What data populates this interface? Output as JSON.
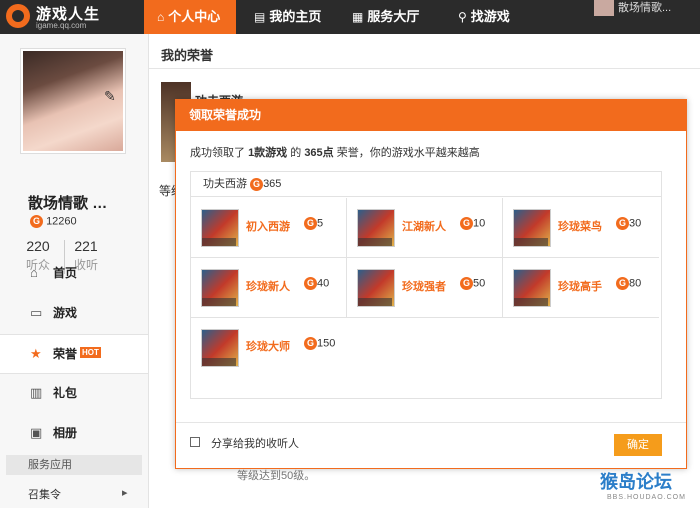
{
  "brand": {
    "name": "游戏人生",
    "subdomain": "igame.qq.com",
    "accent": "#f26b1d"
  },
  "nav": [
    {
      "label": "个人中心",
      "icon": "home-icon",
      "active": true
    },
    {
      "label": "我的主页",
      "icon": "page-icon",
      "active": false
    },
    {
      "label": "服务大厅",
      "icon": "grid-icon",
      "active": false
    },
    {
      "label": "找游戏",
      "icon": "search-icon",
      "active": false
    }
  ],
  "top_user": {
    "name": "散场情歌..."
  },
  "profile": {
    "name": "散场情歌",
    "name_suffix": "…",
    "points": "12260",
    "listeners": {
      "count": "220",
      "label": "听众"
    },
    "following": {
      "count": "221",
      "label": "收听"
    }
  },
  "sidebar": {
    "items": [
      {
        "label": "首页",
        "icon": "home-icon"
      },
      {
        "label": "游戏",
        "icon": "gamepad-icon"
      },
      {
        "label": "荣誉",
        "icon": "star-icon",
        "badge": "HOT",
        "active": true
      },
      {
        "label": "礼包",
        "icon": "gift-icon"
      },
      {
        "label": "相册",
        "icon": "photo-icon"
      }
    ],
    "section_title": "服务应用",
    "section_items": [
      {
        "label": "召集令"
      }
    ]
  },
  "main": {
    "title": "我的荣誉",
    "bg_game": "功夫西游",
    "bg_level_prefix": "等级",
    "bg_footer": "等级达到50级。"
  },
  "dialog": {
    "title": "领取荣誉成功",
    "message": {
      "p1": "成功领取了 ",
      "games": "1款游戏",
      "p2": " 的 ",
      "points": "365点",
      "p3": " 荣誉，你的游戏水平越来越高"
    },
    "game": {
      "name": "功夫西游",
      "points": "365"
    },
    "honors": [
      {
        "name": "初入西游",
        "points": "5"
      },
      {
        "name": "江湖新人",
        "points": "10"
      },
      {
        "name": "珍珑菜鸟",
        "points": "30"
      },
      {
        "name": "珍珑新人",
        "points": "40"
      },
      {
        "name": "珍珑强者",
        "points": "50"
      },
      {
        "name": "珍珑高手",
        "points": "80"
      },
      {
        "name": "珍珑大师",
        "points": "150"
      }
    ],
    "share_label": "分享给我的收听人",
    "confirm_label": "确定"
  },
  "watermark": {
    "text": "猴岛论坛",
    "sub": "BBS.HOUDAO.COM"
  }
}
